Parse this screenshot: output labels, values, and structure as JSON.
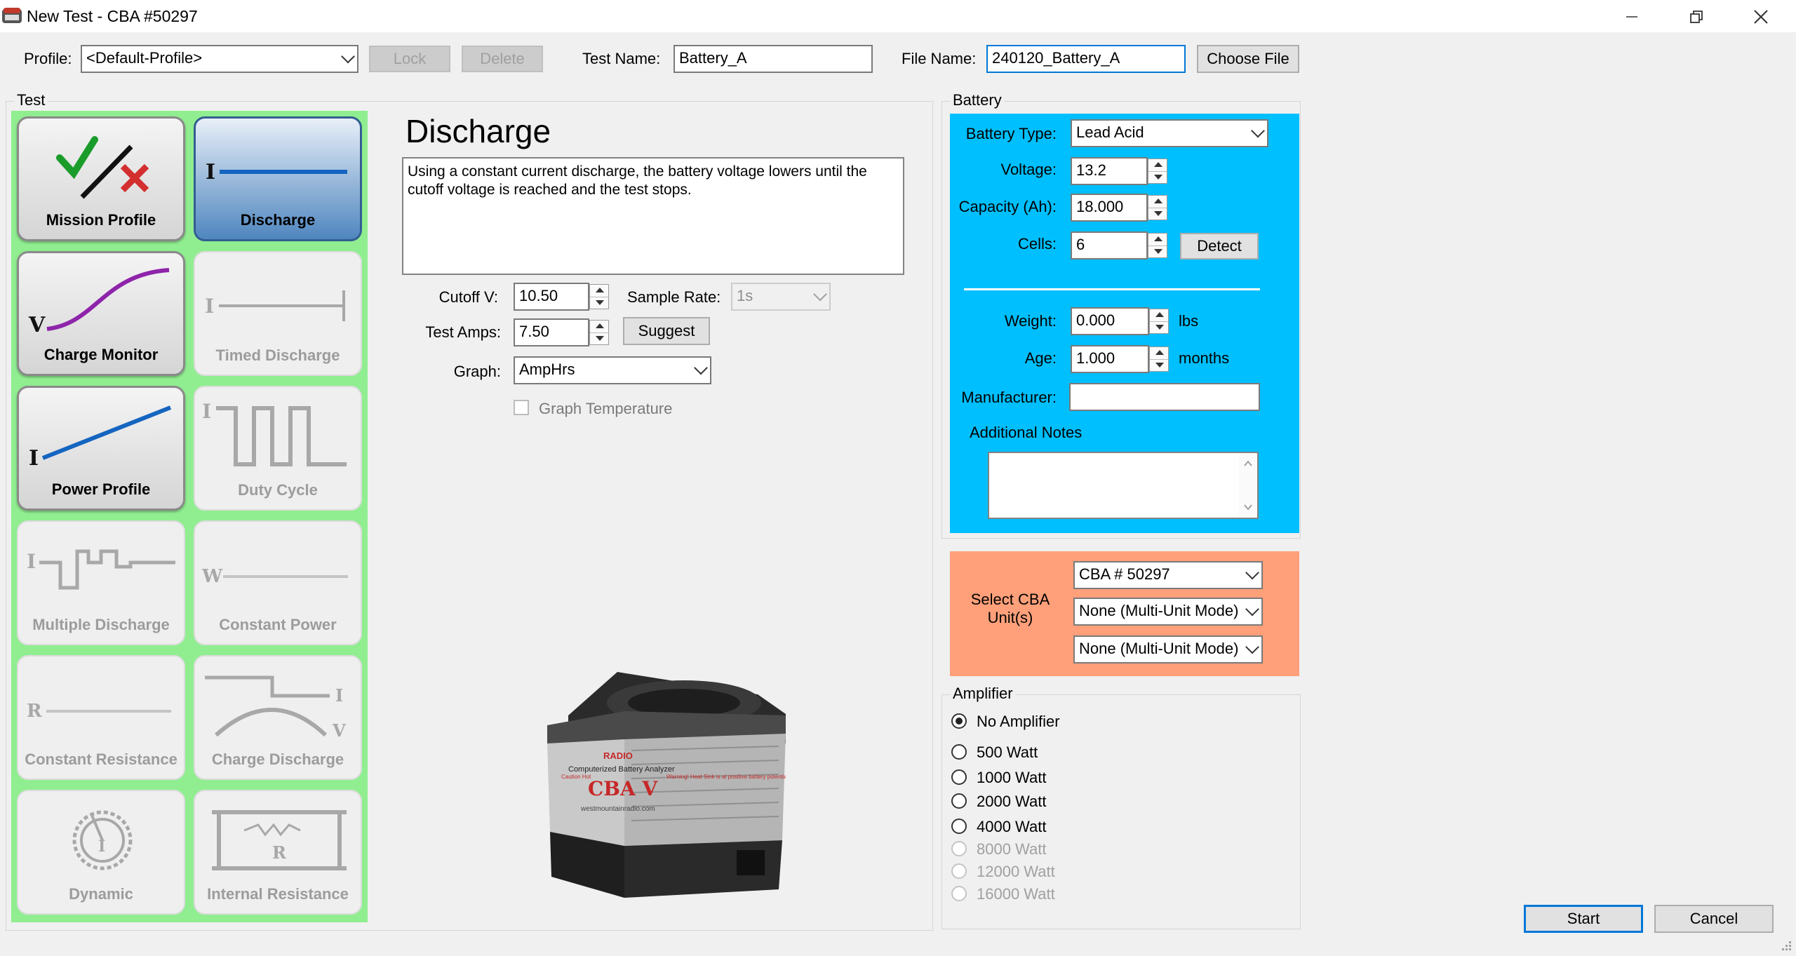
{
  "window": {
    "title": "New Test - CBA #50297"
  },
  "toolbar": {
    "profile_label": "Profile:",
    "profile_value": "<Default-Profile>",
    "lock_label": "Lock",
    "delete_label": "Delete",
    "test_name_label": "Test Name:",
    "test_name_value": "Battery_A",
    "file_name_label": "File Name:",
    "file_name_value": "240120_Battery_A",
    "choose_file_label": "Choose File"
  },
  "test_group": {
    "title": "Test",
    "tiles": [
      {
        "label": "Mission Profile",
        "state": "enabled"
      },
      {
        "label": "Discharge",
        "state": "selected"
      },
      {
        "label": "Charge Monitor",
        "state": "enabled"
      },
      {
        "label": "Timed Discharge",
        "state": "disabled"
      },
      {
        "label": "Power Profile",
        "state": "enabled"
      },
      {
        "label": "Duty Cycle",
        "state": "disabled"
      },
      {
        "label": "Multiple Discharge",
        "state": "disabled"
      },
      {
        "label": "Constant Power",
        "state": "disabled"
      },
      {
        "label": "Constant Resistance",
        "state": "disabled"
      },
      {
        "label": "Charge Discharge",
        "state": "disabled"
      },
      {
        "label": "Dynamic",
        "state": "disabled"
      },
      {
        "label": "Internal Resistance",
        "state": "disabled"
      }
    ],
    "heading": "Discharge",
    "description": "Using a constant current discharge, the battery voltage lowers until the cutoff voltage is reached and the test stops.",
    "cutoff_label": "Cutoff V:",
    "cutoff_value": "10.50",
    "sample_rate_label": "Sample Rate:",
    "sample_rate_value": "1s",
    "test_amps_label": "Test Amps:",
    "test_amps_value": "7.50",
    "suggest_label": "Suggest",
    "graph_label": "Graph:",
    "graph_value": "AmpHrs",
    "graph_temp_label": "Graph Temperature",
    "device_text": {
      "brand": "RADIO",
      "line1": "Computerized Battery Analyzer",
      "model": "CBA V",
      "url": "westmountainradio.com",
      "warning": "Warning! Heat Sink is at positive battery potential",
      "caution": "Caution Hot"
    }
  },
  "battery_group": {
    "title": "Battery",
    "type_label": "Battery Type:",
    "type_value": "Lead Acid",
    "voltage_label": "Voltage:",
    "voltage_value": "13.2",
    "capacity_label": "Capacity (Ah):",
    "capacity_value": "18.000",
    "cells_label": "Cells:",
    "cells_value": "6",
    "detect_label": "Detect",
    "weight_label": "Weight:",
    "weight_value": "0.000",
    "weight_unit": "lbs",
    "age_label": "Age:",
    "age_value": "1.000",
    "age_unit": "months",
    "manufacturer_label": "Manufacturer:",
    "manufacturer_value": "",
    "notes_label": "Additional Notes",
    "notes_value": ""
  },
  "unit_select": {
    "label": "Select CBA Unit(s)",
    "unit1": "CBA # 50297",
    "unit2": "None (Multi-Unit Mode)",
    "unit3": "None (Multi-Unit Mode)"
  },
  "amplifier_group": {
    "title": "Amplifier",
    "options": [
      {
        "label": "No Amplifier",
        "checked": true,
        "disabled": false
      },
      {
        "label": "500 Watt",
        "checked": false,
        "disabled": false
      },
      {
        "label": "1000 Watt",
        "checked": false,
        "disabled": false
      },
      {
        "label": "2000 Watt",
        "checked": false,
        "disabled": false
      },
      {
        "label": "4000 Watt",
        "checked": false,
        "disabled": false
      },
      {
        "label": "8000 Watt",
        "checked": false,
        "disabled": true
      },
      {
        "label": "12000 Watt",
        "checked": false,
        "disabled": true
      },
      {
        "label": "16000 Watt",
        "checked": false,
        "disabled": true
      }
    ]
  },
  "footer": {
    "start_label": "Start",
    "cancel_label": "Cancel"
  },
  "colors": {
    "battery_panel": "#00bfff",
    "unit_panel": "#ffa07a",
    "tile_panel": "#90ee90",
    "accent": "#0078d7"
  }
}
